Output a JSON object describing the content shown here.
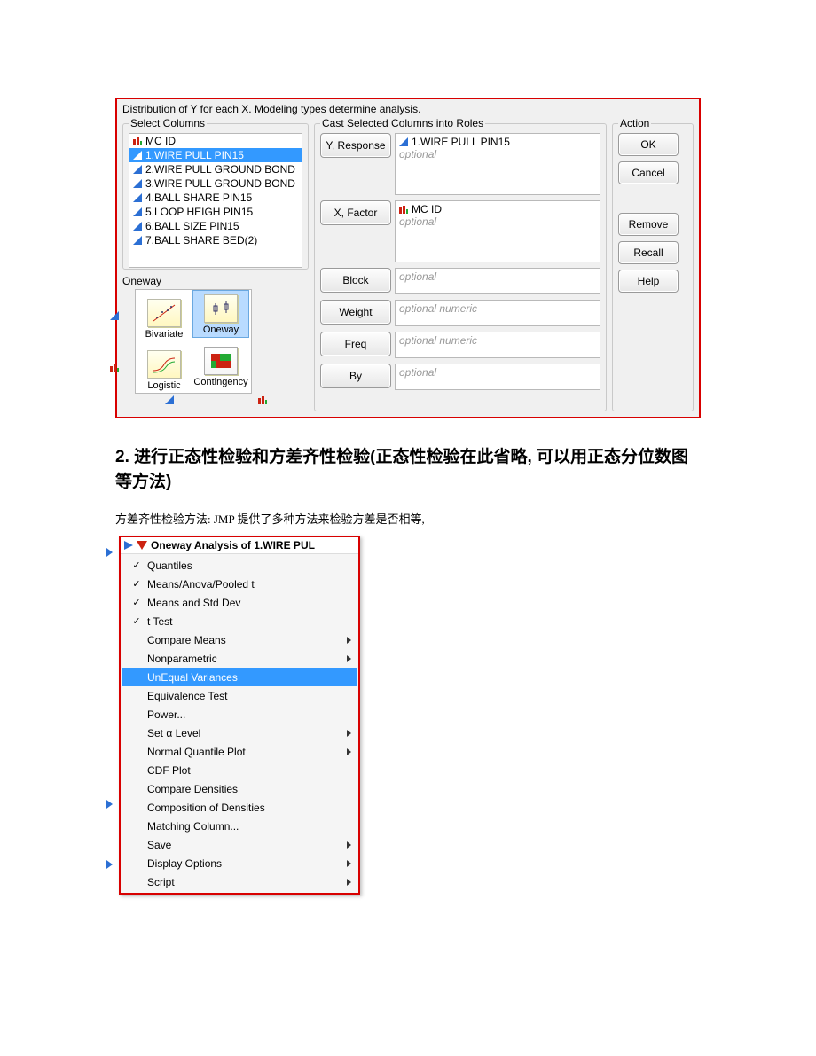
{
  "dialog": {
    "description": "Distribution of Y for each X. Modeling types determine analysis.",
    "select_label": "Select Columns",
    "cast_label": "Cast Selected Columns into Roles",
    "action_label": "Action",
    "columns": [
      {
        "icon": "nominal",
        "label": "MC ID"
      },
      {
        "icon": "continuous",
        "label": "1.WIRE PULL PIN15",
        "selected": true
      },
      {
        "icon": "continuous",
        "label": "2.WIRE PULL GROUND BOND"
      },
      {
        "icon": "continuous",
        "label": "3.WIRE PULL GROUND BOND"
      },
      {
        "icon": "continuous",
        "label": "4.BALL SHARE PIN15"
      },
      {
        "icon": "continuous",
        "label": "5.LOOP HEIGH PIN15"
      },
      {
        "icon": "continuous",
        "label": "6.BALL SIZE PIN15"
      },
      {
        "icon": "continuous",
        "label": "7.BALL SHARE BED(2)"
      }
    ],
    "roles": {
      "y_btn": "Y, Response",
      "y_val": "1.WIRE PULL PIN15",
      "y_opt": "optional",
      "x_btn": "X, Factor",
      "x_val": "MC ID",
      "x_opt": "optional",
      "block_btn": "Block",
      "block_opt": "optional",
      "weight_btn": "Weight",
      "weight_opt": "optional numeric",
      "freq_btn": "Freq",
      "freq_opt": "optional numeric",
      "by_btn": "By",
      "by_opt": "optional"
    },
    "action": {
      "ok": "OK",
      "cancel": "Cancel",
      "remove": "Remove",
      "recall": "Recall",
      "help": "Help"
    },
    "oneway_title": "Oneway",
    "oneway_cells": {
      "bivariate": "Bivariate",
      "oneway": "Oneway",
      "logistic": "Logistic",
      "contingency": "Contingency"
    }
  },
  "heading": "2. 进行正态性检验和方差齐性检验(正态性检验在此省略, 可以用正态分位数图等方法)",
  "body": "方差齐性检验方法: JMP 提供了多种方法来检验方差是否相等,",
  "menu": {
    "title": "Oneway Analysis of 1.WIRE PUL",
    "items": [
      {
        "chk": true,
        "label": "Quantiles"
      },
      {
        "chk": true,
        "label": "Means/Anova/Pooled t"
      },
      {
        "chk": true,
        "label": "Means and Std Dev"
      },
      {
        "chk": true,
        "label": "t Test"
      },
      {
        "chk": false,
        "label": "Compare Means",
        "sub": true
      },
      {
        "chk": false,
        "label": "Nonparametric",
        "sub": true
      },
      {
        "chk": false,
        "label": "UnEqual Variances",
        "sel": true
      },
      {
        "chk": false,
        "label": "Equivalence Test"
      },
      {
        "chk": false,
        "label": "Power..."
      },
      {
        "chk": false,
        "label": "Set α Level",
        "sub": true
      },
      {
        "chk": false,
        "label": "Normal Quantile Plot",
        "sub": true
      },
      {
        "chk": false,
        "label": "CDF Plot"
      },
      {
        "chk": false,
        "label": "Compare Densities"
      },
      {
        "chk": false,
        "label": "Composition of Densities"
      },
      {
        "chk": false,
        "label": "Matching Column..."
      },
      {
        "chk": false,
        "label": "Save",
        "sub": true
      },
      {
        "chk": false,
        "label": "Display Options",
        "sub": true
      },
      {
        "chk": false,
        "label": "Script",
        "sub": true
      }
    ]
  }
}
